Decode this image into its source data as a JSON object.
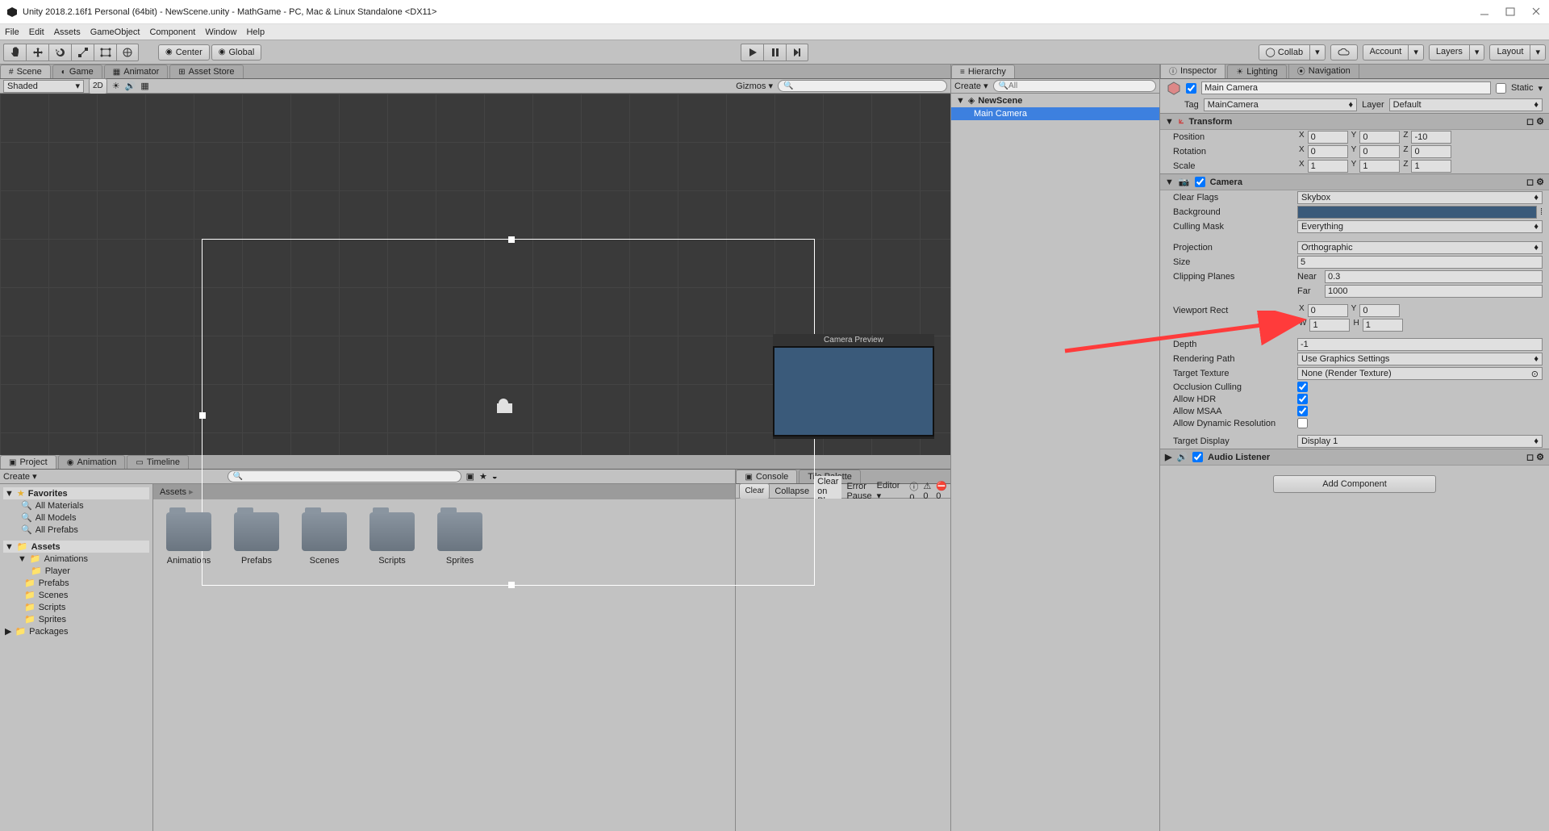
{
  "title": "Unity 2018.2.16f1 Personal (64bit) - NewScene.unity - MathGame - PC, Mac & Linux Standalone <DX11>",
  "menu": [
    "File",
    "Edit",
    "Assets",
    "GameObject",
    "Component",
    "Window",
    "Help"
  ],
  "toolbar": {
    "center": "Center",
    "global": "Global",
    "collab": "Collab",
    "account": "Account",
    "layers": "Layers",
    "layout": "Layout"
  },
  "sceneTabs": {
    "scene": "Scene",
    "game": "Game",
    "animator": "Animator",
    "assetstore": "Asset Store"
  },
  "sceneBar": {
    "shaded": "Shaded",
    "twoD": "2D",
    "gizmos": "Gizmos"
  },
  "camPreview": "Camera Preview",
  "bottomTabs": {
    "project": "Project",
    "animation": "Animation",
    "timeline": "Timeline",
    "console": "Console",
    "tilepalette": "Tile Palette"
  },
  "projBar": {
    "create": "Create"
  },
  "consoleBar": {
    "clear": "Clear",
    "collapse": "Collapse",
    "clearplay": "Clear on Play",
    "errpause": "Error Pause",
    "editor": "Editor"
  },
  "favorites": {
    "title": "Favorites",
    "items": [
      "All Materials",
      "All Models",
      "All Prefabs"
    ]
  },
  "assets": {
    "title": "Assets",
    "items": [
      "Animations",
      "Player",
      "Prefabs",
      "Scenes",
      "Scripts",
      "Sprites"
    ]
  },
  "packages": "Packages",
  "assetsHdr": "Assets",
  "folders": [
    "Animations",
    "Prefabs",
    "Scenes",
    "Scripts",
    "Sprites"
  ],
  "hierarchy": {
    "tab": "Hierarchy",
    "create": "Create",
    "scene": "NewScene",
    "camera": "Main Camera"
  },
  "inspTabs": {
    "inspector": "Inspector",
    "lighting": "Lighting",
    "navigation": "Navigation"
  },
  "inspector": {
    "name": "Main Camera",
    "static": "Static",
    "tag": "Tag",
    "tagval": "MainCamera",
    "layer": "Layer",
    "layerval": "Default",
    "transform": "Transform",
    "pos": "Position",
    "rot": "Rotation",
    "scale": "Scale",
    "posX": "0",
    "posY": "0",
    "posZ": "-10",
    "rotX": "0",
    "rotY": "0",
    "rotZ": "0",
    "scaleX": "1",
    "scaleY": "1",
    "scaleZ": "1",
    "camera": "Camera",
    "clearflags": "Clear Flags",
    "clearflagsval": "Skybox",
    "background": "Background",
    "cullmask": "Culling Mask",
    "cullmaskval": "Everything",
    "projection": "Projection",
    "projectionval": "Orthographic",
    "size": "Size",
    "sizeval": "5",
    "clipping": "Clipping Planes",
    "near": "Near",
    "nearval": "0.3",
    "far": "Far",
    "farval": "1000",
    "viewport": "Viewport Rect",
    "vX": "0",
    "vY": "0",
    "vW": "1",
    "vH": "1",
    "depth": "Depth",
    "depthval": "-1",
    "renderpath": "Rendering Path",
    "renderpathval": "Use Graphics Settings",
    "targettex": "Target Texture",
    "targettexval": "None (Render Texture)",
    "occlusion": "Occlusion Culling",
    "hdr": "Allow HDR",
    "msaa": "Allow MSAA",
    "dynres": "Allow Dynamic Resolution",
    "targetdisp": "Target Display",
    "targetdispval": "Display 1",
    "audiolistener": "Audio Listener",
    "addcomp": "Add Component"
  }
}
